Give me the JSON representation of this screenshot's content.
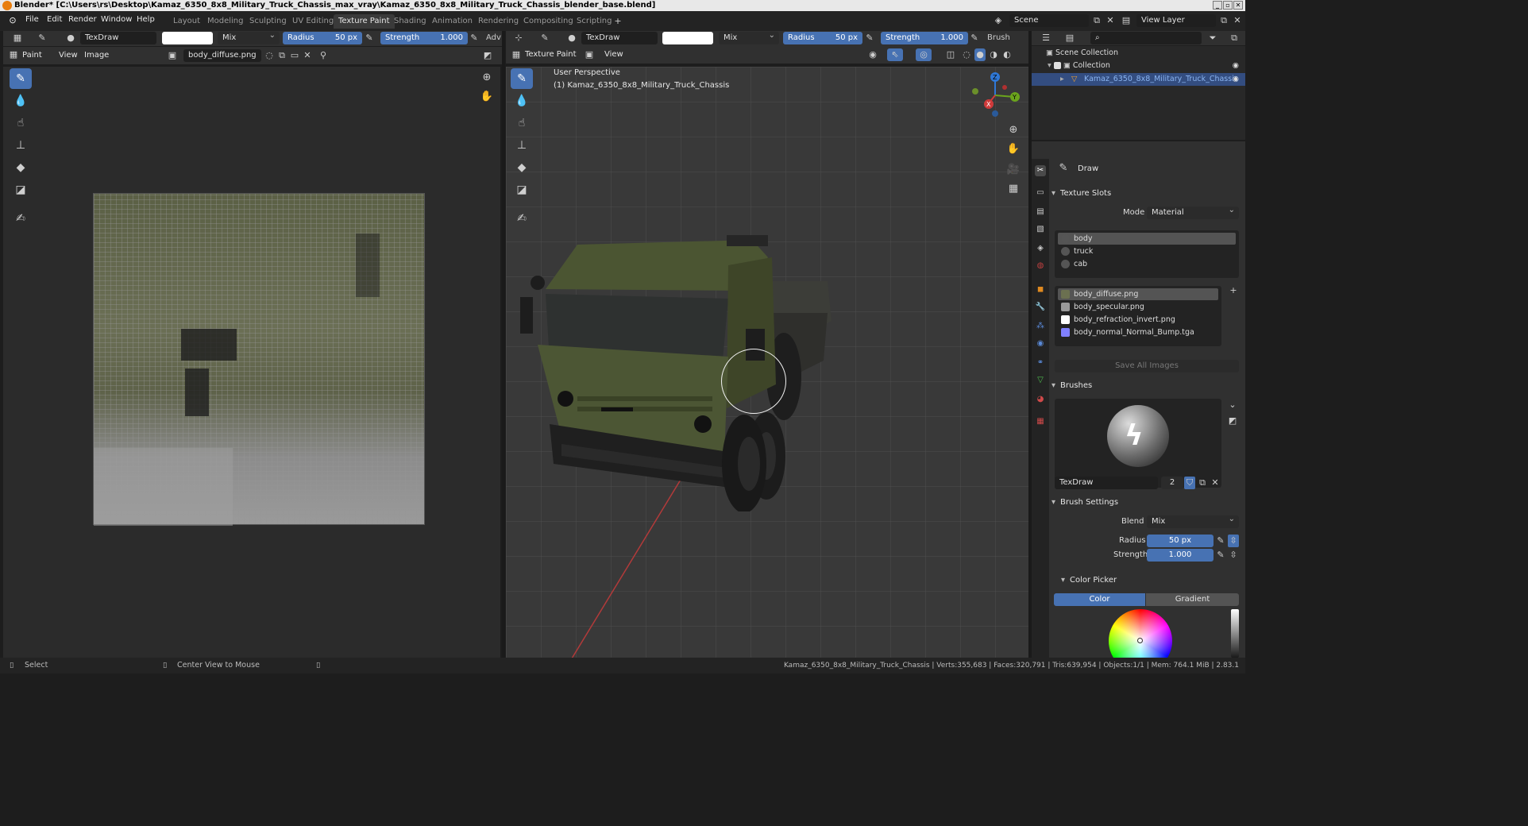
{
  "window": {
    "title": "Blender* [C:\\Users\\rs\\Desktop\\Kamaz_6350_8x8_Military_Truck_Chassis_max_vray\\Kamaz_6350_8x8_Military_Truck_Chassis_blender_base.blend]"
  },
  "menu": [
    "File",
    "Edit",
    "Render",
    "Window",
    "Help"
  ],
  "workspaces": [
    "Layout",
    "Modeling",
    "Sculpting",
    "UV Editing",
    "Texture Paint",
    "Shading",
    "Animation",
    "Rendering",
    "Compositing",
    "Scripting"
  ],
  "active_workspace": "Texture Paint",
  "scene": {
    "label": "Scene",
    "view_layer": "View Layer"
  },
  "image_editor": {
    "tool_header": {
      "brush": "TexDraw",
      "blend": "Mix",
      "radius_label": "Radius",
      "radius": "50 px",
      "strength_label": "Strength",
      "strength": "1.000",
      "adv": "Adv"
    },
    "header": {
      "mode": "Paint",
      "view": "View",
      "image": "Image",
      "image_name": "body_diffuse.png"
    }
  },
  "viewport": {
    "tool_header": {
      "brush": "TexDraw",
      "blend": "Mix",
      "radius_label": "Radius",
      "radius": "50 px",
      "strength_label": "Strength",
      "strength": "1.000",
      "brush_menu": "Brush"
    },
    "header": {
      "mode": "Texture Paint",
      "view": "View"
    },
    "overlay_text": {
      "perspective": "User Perspective",
      "object": "(1) Kamaz_6350_8x8_Military_Truck_Chassis"
    },
    "gizmo": {
      "x": "X",
      "y": "Y",
      "z": "Z"
    }
  },
  "outliner": {
    "root": "Scene Collection",
    "collection": "Collection",
    "object": "Kamaz_6350_8x8_Military_Truck_Chassis"
  },
  "properties": {
    "brush_name": "Draw",
    "texture_slots": {
      "title": "Texture Slots",
      "mode_label": "Mode",
      "mode": "Material",
      "materials": [
        "body",
        "truck",
        "cab"
      ],
      "images": [
        {
          "name": "body_diffuse.png",
          "color": "#6b7050"
        },
        {
          "name": "body_specular.png",
          "color": "#9a9a9a"
        },
        {
          "name": "body_refraction_invert.png",
          "color": "#ffffff"
        },
        {
          "name": "body_normal_Normal_Bump.tga",
          "color": "#8080ff"
        }
      ],
      "save_all": "Save All Images"
    },
    "brushes": {
      "title": "Brushes",
      "name": "TexDraw",
      "users": "2"
    },
    "brush_settings": {
      "title": "Brush Settings",
      "blend_label": "Blend",
      "blend": "Mix",
      "radius_label": "Radius",
      "radius": "50 px",
      "strength_label": "Strength",
      "strength": "1.000"
    },
    "color_picker": {
      "title": "Color Picker",
      "tab_color": "Color",
      "tab_gradient": "Gradient"
    }
  },
  "statusbar": {
    "select": "Select",
    "center": "Center View to Mouse",
    "stats": "Kamaz_6350_8x8_Military_Truck_Chassis | Verts:355,683 | Faces:320,791 | Tris:639,954 | Objects:1/1 | Mem: 764.1 MiB | 2.83.1"
  }
}
